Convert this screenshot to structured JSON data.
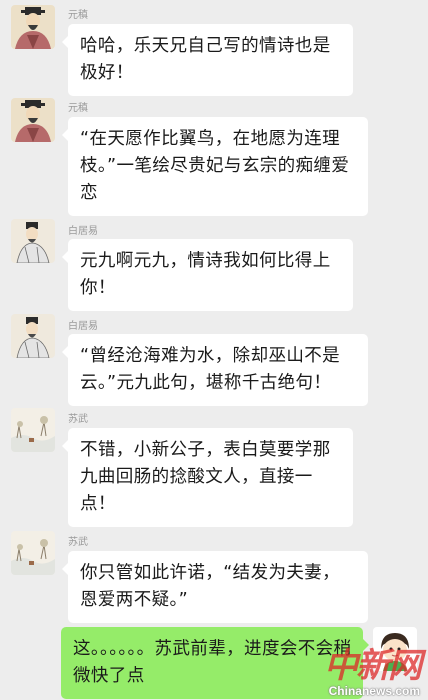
{
  "messages": [
    {
      "sender": "元稹",
      "text": "哈哈，乐天兄自己写的情诗也是极好！",
      "avatar": "yuanzhen-portrait"
    },
    {
      "sender": "元稹",
      "text": "“在天愿作比翼鸟，在地愿为连理枝。”一笔绘尽贵妃与玄宗的痴缠爱恋",
      "avatar": "yuanzhen-portrait"
    },
    {
      "sender": "白居易",
      "text": "元九啊元九，情诗我如何比得上你！",
      "avatar": "baijuyi-portrait"
    },
    {
      "sender": "白居易",
      "text": "“曾经沧海难为水，除却巫山不是云。”元九此句，堪称千古绝句！",
      "avatar": "baijuyi-portrait"
    },
    {
      "sender": "苏武",
      "text": "不错，小新公子，表白莫要学那九曲回肠的捻酸文人，直接一点！",
      "avatar": "suwu-snow-landscape"
    },
    {
      "sender": "苏武",
      "text": "你只管如此许诺，“结发为夫妻，恩爱两不疑。”",
      "avatar": "suwu-snow-landscape"
    }
  ],
  "self_message": {
    "text": "这。。。。。。苏武前辈，进度会不会稍微快了点",
    "avatar": "cartoon-boy-avatar"
  },
  "watermark": {
    "cn": "中新网",
    "en": "Chinanews.com"
  },
  "colors": {
    "background": "#ededed",
    "bubble_other": "#ffffff",
    "bubble_self": "#95ec69"
  }
}
